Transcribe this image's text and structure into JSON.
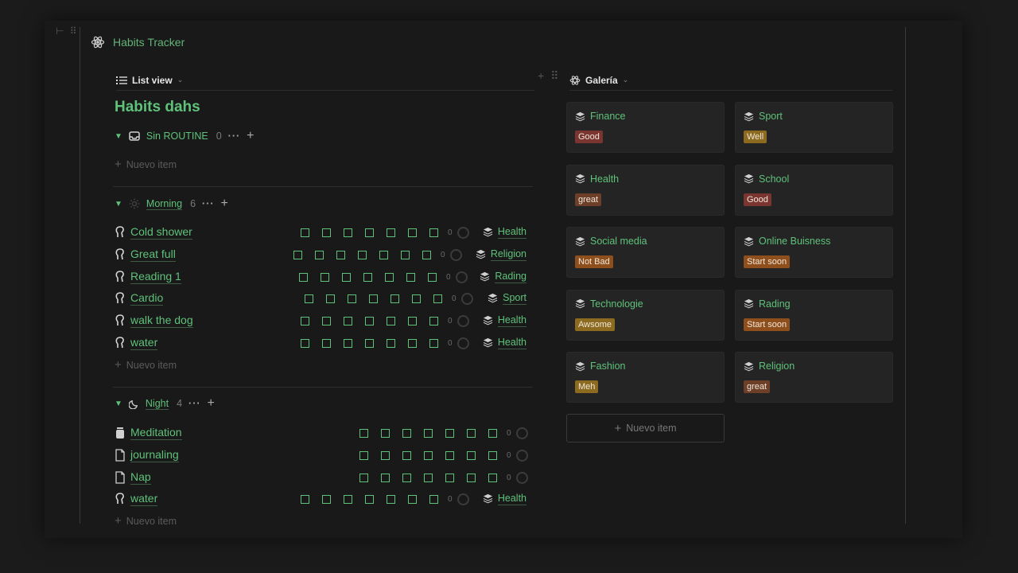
{
  "app": {
    "title": "Habits Tracker"
  },
  "list_view": {
    "label": "List view",
    "title": "Habits dahs"
  },
  "groups": [
    {
      "name": "Sin ROUTINE",
      "count": "0"
    },
    {
      "name": "Morning",
      "count": "6"
    },
    {
      "name": "Night",
      "count": "4"
    }
  ],
  "new_item_label": "Nuevo item",
  "morning": [
    {
      "name": "Cold shower",
      "count": "0",
      "tag": "Health"
    },
    {
      "name": "Great full",
      "count": "0",
      "tag": "Religion"
    },
    {
      "name": "Reading 1",
      "count": "0",
      "tag": "Rading"
    },
    {
      "name": "Cardio",
      "count": "0",
      "tag": "Sport"
    },
    {
      "name": "walk the dog",
      "count": "0",
      "tag": "Health"
    },
    {
      "name": "water",
      "count": "0",
      "tag": "Health"
    }
  ],
  "night": [
    {
      "name": "Meditation",
      "count": "0"
    },
    {
      "name": "journaling",
      "count": "0"
    },
    {
      "name": "Nap",
      "count": "0"
    },
    {
      "name": "water",
      "count": "0",
      "tag": "Health"
    }
  ],
  "gallery": {
    "label": "Galería",
    "cards": [
      {
        "name": "Finance",
        "status": "Good"
      },
      {
        "name": "Sport",
        "status": "Well"
      },
      {
        "name": "Health",
        "status": "great"
      },
      {
        "name": "School",
        "status": "Good"
      },
      {
        "name": "Social media",
        "status": "Not Bad"
      },
      {
        "name": "Online Buisness",
        "status": "Start soon"
      },
      {
        "name": "Technologie",
        "status": "Awsome"
      },
      {
        "name": "Rading",
        "status": "Start soon"
      },
      {
        "name": "Fashion",
        "status": "Meh"
      },
      {
        "name": "Religion",
        "status": "great"
      }
    ],
    "new_item_label": "Nuevo item"
  },
  "colors": {
    "accent_green": "#5fc27a",
    "badge_red": "#7a3530",
    "badge_gold": "#8c6a1f",
    "badge_brown": "#6e3f28",
    "badge_orange": "#8f4f1c"
  }
}
